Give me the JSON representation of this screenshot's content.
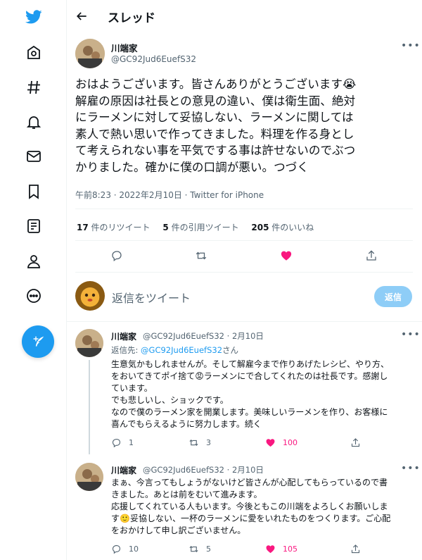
{
  "app": {
    "accent": "#1d9bf0",
    "like_color": "#f91880"
  },
  "nav": {
    "items": [
      "twitter-logo",
      "home-icon",
      "explore-icon",
      "notifications-icon",
      "messages-icon",
      "bookmarks-icon",
      "lists-icon",
      "profile-icon",
      "more-icon"
    ],
    "compose": "compose-icon"
  },
  "header": {
    "title": "スレッド"
  },
  "tweet": {
    "author": "川端家",
    "handle": "@GC92Jud6EuefS32",
    "text": "おはようございます。皆さんありがとうございます😭\n解雇の原因は社長との意見の違い、僕は衛生面、絶対\nにラーメンに対して妥協しない、ラーメンに関しては\n素人で熱い思いで作ってきました。料理を作る身とし\nて考えられない事を平気でする事は許せないのでぶつ\nかりました。確かに僕の口調が悪い。つづく",
    "meta": "午前8:23 · 2022年2月10日 · Twitter for iPhone",
    "stats": {
      "retweets": "17",
      "retweets_label": "件のリツイート",
      "quotes": "5",
      "quotes_label": "件の引用ツイート",
      "likes": "205",
      "likes_label": "件のいいね"
    }
  },
  "reply_box": {
    "placeholder": "返信をツイート",
    "button": "返信"
  },
  "replies": [
    {
      "author": "川端家",
      "handle_date": "@GC92Jud6EuefS32 · 2月10日",
      "replying_prefix": "返信先: ",
      "replying_mention": "@GC92Jud6EuefS32",
      "replying_suffix": "さん",
      "text": "生意気かもしれませんが。そして解雇今まで作りあげたレシピ、やり方、\nをおいてきてポイ捨て😡ラーメンにで合してくれたのは社長です。感謝し\nています。\nでも悲しいし、ショックです。\nなので僕のラーメン家を開業します。美味しいラーメンを作り、お客様に\n喜んでもらえるように努力します。続く",
      "replies": "1",
      "retweets": "3",
      "likes": "100"
    },
    {
      "author": "川端家",
      "handle_date": "@GC92Jud6EuefS32 · 2月10日",
      "text": "まぁ、今言ってもしょうがないけど皆さんが心配してもらっているので書\nきました。あとは前をむいて進みます。\n応援してくれている人もいます。今後ともこの川端をよろしくお願いしま\nす🙂妥協しない、一杯のラーメンに愛をいれたものをつくります。ご心配\nをおかけして申し訳ございません。",
      "replies": "10",
      "retweets": "5",
      "likes": "105"
    }
  ]
}
